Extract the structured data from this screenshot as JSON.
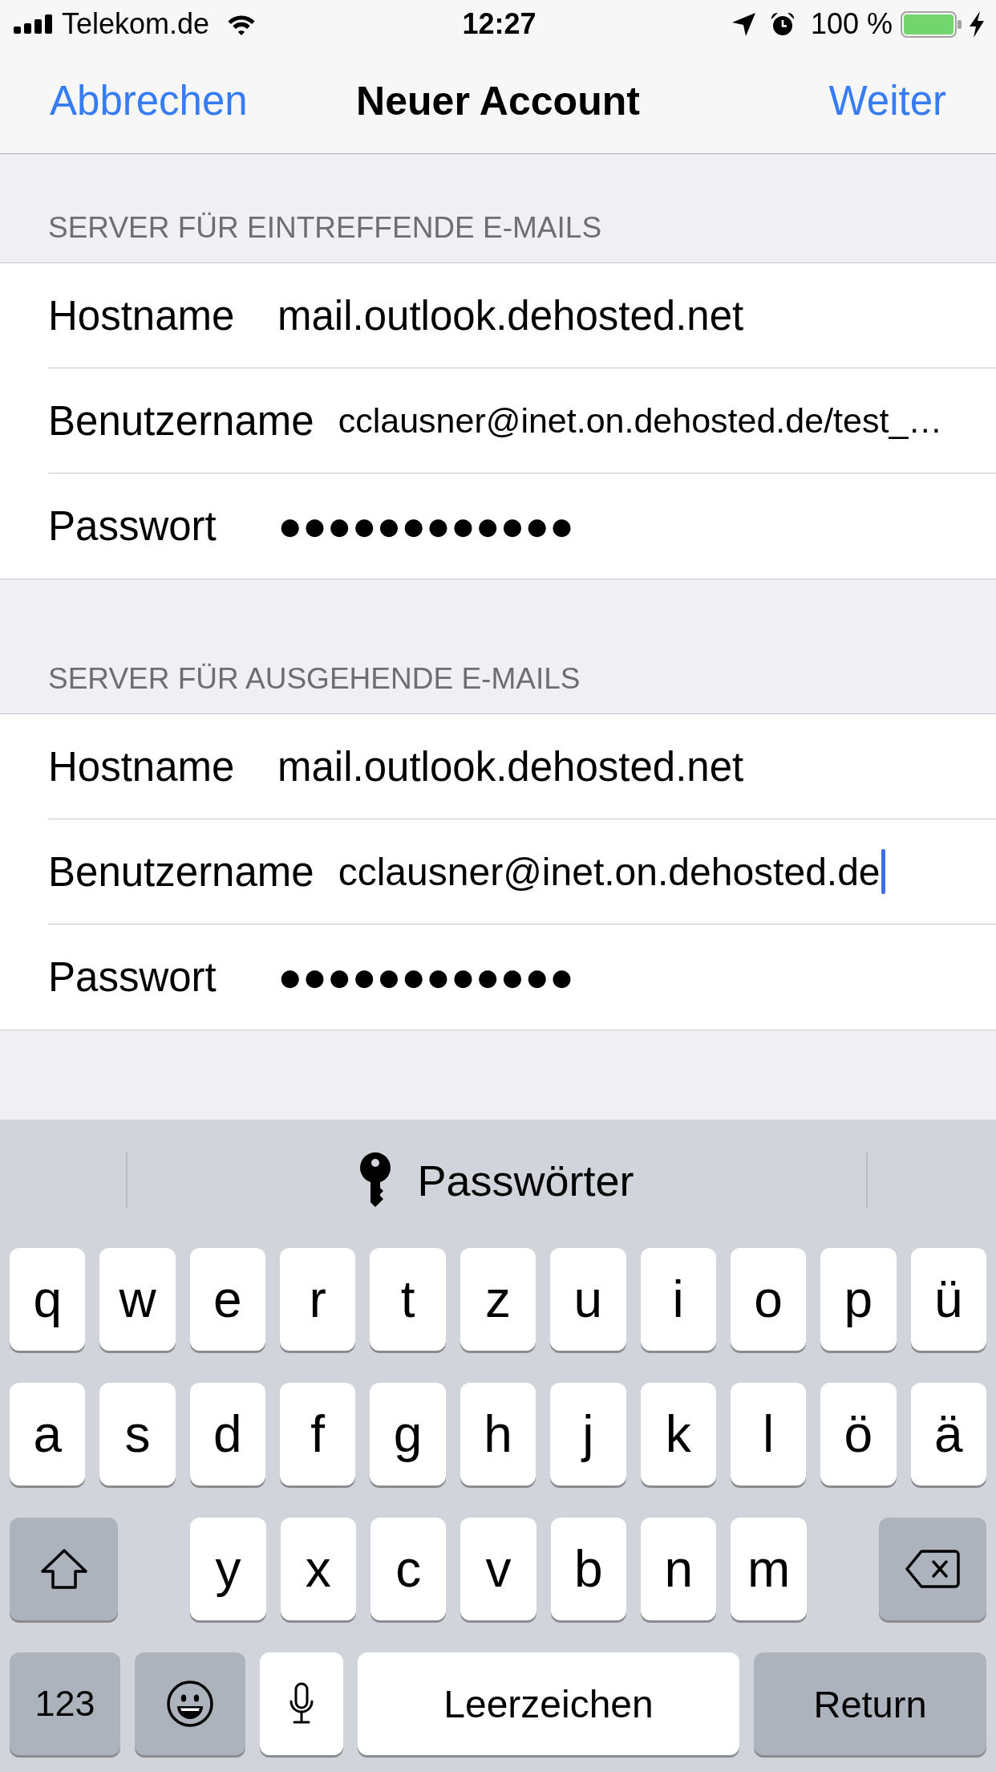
{
  "status_bar": {
    "carrier": "Telekom.de",
    "time": "12:27",
    "battery": "100 %"
  },
  "nav_bar": {
    "cancel": "Abbrechen",
    "title": "Neuer Account",
    "next": "Weiter"
  },
  "sections": [
    {
      "header": "SERVER FÜR EINTREFFENDE E-MAILS",
      "rows": [
        {
          "label": "Hostname",
          "value": "mail.outlook.dehosted.net",
          "kind": "text",
          "focused": false
        },
        {
          "label": "Benutzername",
          "value": "cclausner@inet.on.dehosted.de/test_…",
          "kind": "email",
          "focused": false
        },
        {
          "label": "Passwort",
          "value": "●●●●●●●●●●●●",
          "kind": "password",
          "focused": false
        }
      ]
    },
    {
      "header": "SERVER FÜR AUSGEHENDE E-MAILS",
      "rows": [
        {
          "label": "Hostname",
          "value": "mail.outlook.dehosted.net",
          "kind": "text",
          "focused": false
        },
        {
          "label": "Benutzername",
          "value": "cclausner@inet.on.dehosted.de",
          "kind": "email",
          "focused": true
        },
        {
          "label": "Passwort",
          "value": "●●●●●●●●●●●●",
          "kind": "password",
          "focused": false
        }
      ]
    }
  ],
  "keyboard": {
    "suggestion": "Passwörter",
    "rows": [
      {
        "keys": [
          {
            "kind": "letter",
            "label": "q"
          },
          {
            "kind": "letter",
            "label": "w"
          },
          {
            "kind": "letter",
            "label": "e"
          },
          {
            "kind": "letter",
            "label": "r"
          },
          {
            "kind": "letter",
            "label": "t"
          },
          {
            "kind": "letter",
            "label": "z"
          },
          {
            "kind": "letter",
            "label": "u"
          },
          {
            "kind": "letter",
            "label": "i"
          },
          {
            "kind": "letter",
            "label": "o"
          },
          {
            "kind": "letter",
            "label": "p"
          },
          {
            "kind": "letter",
            "label": "ü"
          }
        ]
      },
      {
        "keys": [
          {
            "kind": "letter",
            "label": "a"
          },
          {
            "kind": "letter",
            "label": "s"
          },
          {
            "kind": "letter",
            "label": "d"
          },
          {
            "kind": "letter",
            "label": "f"
          },
          {
            "kind": "letter",
            "label": "g"
          },
          {
            "kind": "letter",
            "label": "h"
          },
          {
            "kind": "letter",
            "label": "j"
          },
          {
            "kind": "letter",
            "label": "k"
          },
          {
            "kind": "letter",
            "label": "l"
          },
          {
            "kind": "letter",
            "label": "ö"
          },
          {
            "kind": "letter",
            "label": "ä"
          }
        ]
      },
      {
        "keys": [
          {
            "kind": "shift"
          },
          {
            "kind": "letter",
            "label": "y"
          },
          {
            "kind": "letter",
            "label": "x"
          },
          {
            "kind": "letter",
            "label": "c"
          },
          {
            "kind": "letter",
            "label": "v"
          },
          {
            "kind": "letter",
            "label": "b"
          },
          {
            "kind": "letter",
            "label": "n"
          },
          {
            "kind": "letter",
            "label": "m"
          },
          {
            "kind": "delete"
          }
        ]
      },
      {
        "keys": [
          {
            "kind": "numbers",
            "label": "123"
          },
          {
            "kind": "emoji"
          },
          {
            "kind": "dictation"
          },
          {
            "kind": "space",
            "label": "Leerzeichen"
          },
          {
            "kind": "return",
            "label": "Return"
          }
        ]
      }
    ]
  }
}
